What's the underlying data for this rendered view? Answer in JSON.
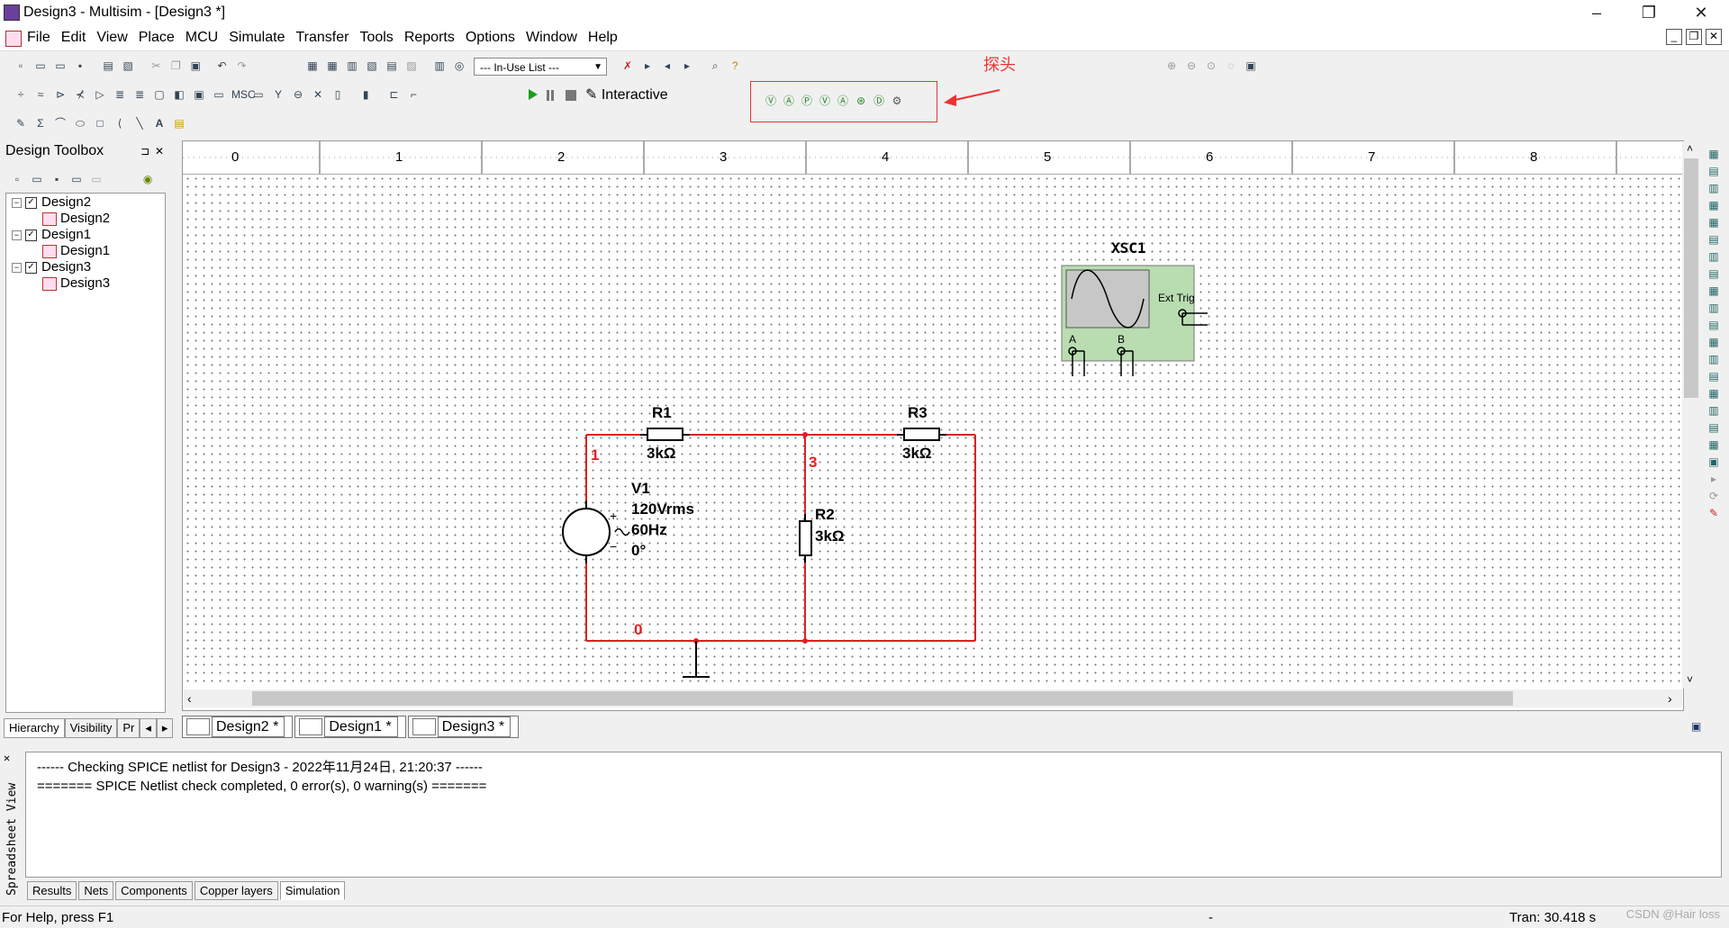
{
  "window": {
    "title": "Design3 - Multisim - [Design3 *]",
    "controls": {
      "minimize": "–",
      "maximize": "❐",
      "close": "✕"
    }
  },
  "menu": [
    "File",
    "Edit",
    "View",
    "Place",
    "MCU",
    "Simulate",
    "Transfer",
    "Tools",
    "Reports",
    "Options",
    "Window",
    "Help"
  ],
  "toolbar": {
    "in_use_list": "--- In-Use List ---",
    "interactive_label": "Interactive"
  },
  "annotation": {
    "probe_label": "探头",
    "color": "#e33333"
  },
  "toolbox": {
    "title": "Design Toolbox",
    "tree": [
      {
        "label": "Design2",
        "child": "Design2"
      },
      {
        "label": "Design1",
        "child": "Design1"
      },
      {
        "label": "Design3",
        "child": "Design3"
      }
    ],
    "tabs": [
      "Hierarchy",
      "Visibility",
      "Pr"
    ]
  },
  "ruler": {
    "ticks": [
      "0",
      "1",
      "2",
      "3",
      "4",
      "5",
      "6",
      "7",
      "8"
    ]
  },
  "schematic": {
    "wire_color": "#e02020",
    "oscilloscope": {
      "name": "XSC1",
      "ext_trig": "Ext Trig",
      "channel_a": "A",
      "channel_b": "B"
    },
    "R1": {
      "name": "R1",
      "value": "3kΩ"
    },
    "R2": {
      "name": "R2",
      "value": "3kΩ"
    },
    "R3": {
      "name": "R3",
      "value": "3kΩ"
    },
    "V1": {
      "name": "V1",
      "voltage": "120Vrms",
      "freq": "60Hz",
      "phase": "0°"
    },
    "nodes": {
      "n1": "1",
      "n3": "3",
      "n0": "0"
    }
  },
  "sheet_tabs": [
    "Design2 *",
    "Design1 *",
    "Design3 *"
  ],
  "spreadsheet": {
    "side_label": "Spreadsheet View",
    "lines": [
      "------ Checking SPICE netlist for Design3 - 2022年11月24日, 21:20:37 ------",
      "======= SPICE Netlist check completed, 0 error(s), 0 warning(s) ======="
    ],
    "tabs": [
      "Results",
      "Nets",
      "Components",
      "Copper layers",
      "Simulation"
    ]
  },
  "status": {
    "help": "For Help, press F1",
    "dash": "-",
    "tran": "Tran: 30.418 s"
  },
  "watermark": "CSDN @Hair loss"
}
